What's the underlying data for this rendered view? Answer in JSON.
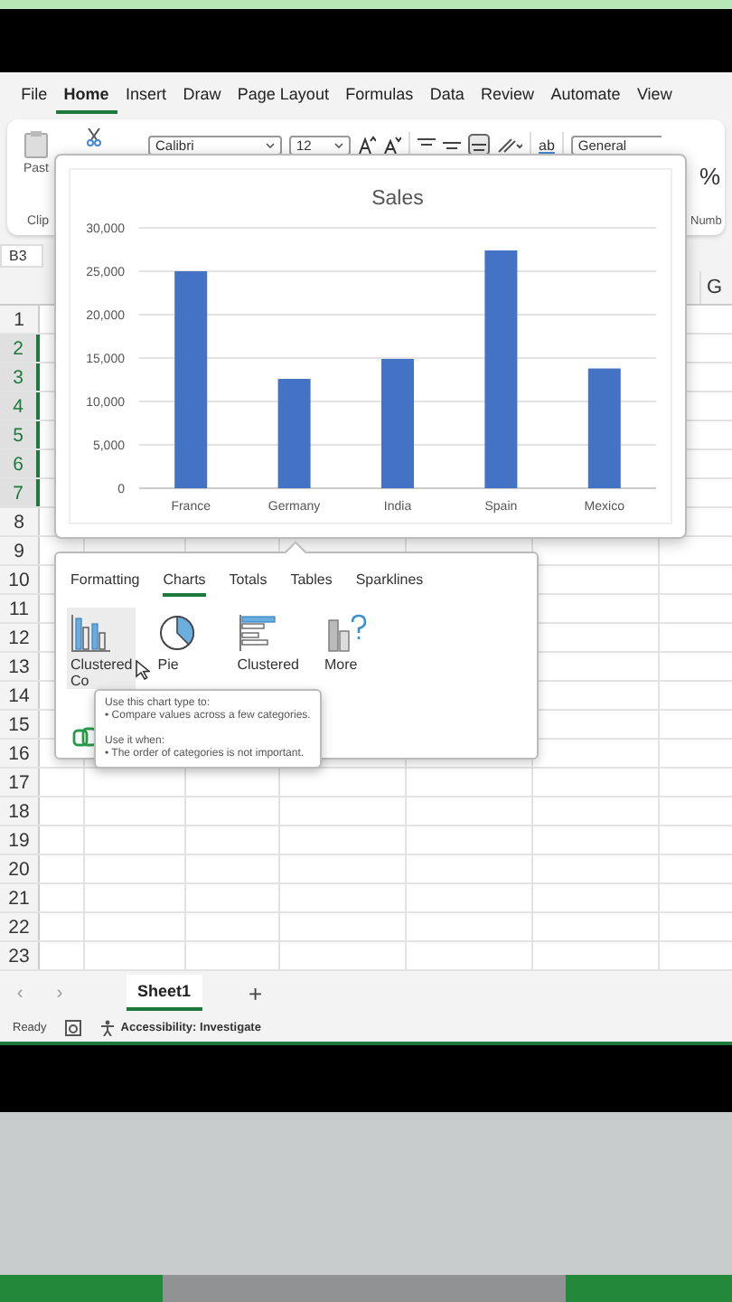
{
  "menu_tabs": [
    {
      "label": "File",
      "selected": false
    },
    {
      "label": "Home",
      "selected": true
    },
    {
      "label": "Insert",
      "selected": false
    },
    {
      "label": "Draw",
      "selected": false
    },
    {
      "label": "Page Layout",
      "selected": false
    },
    {
      "label": "Formulas",
      "selected": false
    },
    {
      "label": "Data",
      "selected": false
    },
    {
      "label": "Review",
      "selected": false
    },
    {
      "label": "Automate",
      "selected": false
    },
    {
      "label": "View",
      "selected": false
    }
  ],
  "ribbon": {
    "paste_label": "Past",
    "clipboard_group": "Clip",
    "font_name": "Calibri",
    "font_size": "12",
    "wrap_label": "ab",
    "number_format": "General",
    "percent": "%",
    "number_group": "Numb"
  },
  "name_box": "B3",
  "column_headers": [
    "G"
  ],
  "rows": [
    {
      "label": "1",
      "selected": false
    },
    {
      "label": "2",
      "selected": true
    },
    {
      "label": "3",
      "selected": true
    },
    {
      "label": "4",
      "selected": true
    },
    {
      "label": "5",
      "selected": true
    },
    {
      "label": "6",
      "selected": true
    },
    {
      "label": "7",
      "selected": true
    },
    {
      "label": "8",
      "selected": false
    },
    {
      "label": "9",
      "selected": false
    },
    {
      "label": "10",
      "selected": false
    },
    {
      "label": "11",
      "selected": false
    },
    {
      "label": "12",
      "selected": false
    },
    {
      "label": "13",
      "selected": false
    },
    {
      "label": "14",
      "selected": false
    },
    {
      "label": "15",
      "selected": false
    },
    {
      "label": "16",
      "selected": false
    },
    {
      "label": "17",
      "selected": false
    },
    {
      "label": "18",
      "selected": false
    },
    {
      "label": "19",
      "selected": false
    },
    {
      "label": "20",
      "selected": false
    },
    {
      "label": "21",
      "selected": false
    },
    {
      "label": "22",
      "selected": false
    },
    {
      "label": "23",
      "selected": false
    }
  ],
  "chart_preview": {
    "chart_data": {
      "type": "bar",
      "title": "Sales",
      "categories": [
        "France",
        "Germany",
        "India",
        "Spain",
        "Mexico"
      ],
      "values": [
        25000,
        12600,
        14900,
        27400,
        13800
      ],
      "grid": true,
      "ylim": [
        0,
        30000
      ],
      "yticks": [
        {
          "value": 0,
          "label": "0"
        },
        {
          "value": 5000,
          "label": "5,000"
        },
        {
          "value": 10000,
          "label": "10,000"
        },
        {
          "value": 15000,
          "label": "15,000"
        },
        {
          "value": 20000,
          "label": "20,000"
        },
        {
          "value": 25000,
          "label": "25,000"
        },
        {
          "value": 30000,
          "label": "30,000"
        }
      ]
    }
  },
  "quick_analysis": {
    "tabs": [
      {
        "label": "Formatting",
        "selected": false
      },
      {
        "label": "Charts",
        "selected": true
      },
      {
        "label": "Totals",
        "selected": false
      },
      {
        "label": "Tables",
        "selected": false
      },
      {
        "label": "Sparklines",
        "selected": false
      }
    ],
    "items": [
      {
        "kind": "column",
        "label": "Clustered Co",
        "selected": true
      },
      {
        "kind": "pie",
        "label": "Pie",
        "selected": false
      },
      {
        "kind": "bar",
        "label": "Clustered",
        "selected": false
      },
      {
        "kind": "more",
        "label": "More",
        "selected": false
      }
    ]
  },
  "tooltip": {
    "lines": [
      "Use this chart type to:",
      "• Compare values across a few categories.",
      "Use it when:",
      "• The order of categories is not important."
    ]
  },
  "sheet_tabs": [
    {
      "label": "Sheet1",
      "selected": true
    }
  ],
  "sheet_nav": [
    "‹",
    "›"
  ],
  "add_sheet": "+",
  "status": {
    "ready": "Ready",
    "accessibility": "Accessibility: Investigate"
  }
}
